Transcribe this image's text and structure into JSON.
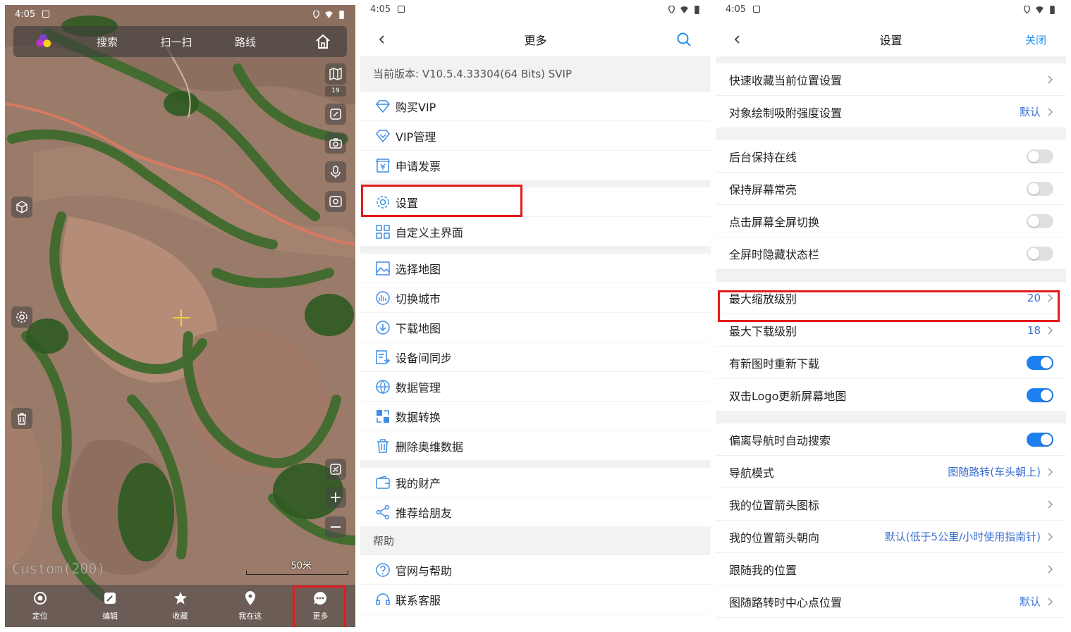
{
  "status": {
    "time": "4:05"
  },
  "map_panel": {
    "topbar": {
      "tabs": [
        "搜索",
        "扫一扫",
        "路线"
      ]
    },
    "zoom_level": "19",
    "map_source_label": "Custom(200)",
    "scale_label": "50米",
    "bottom_nav": [
      {
        "label": "定位",
        "icon": "locate-icon"
      },
      {
        "label": "编辑",
        "icon": "edit-icon"
      },
      {
        "label": "收藏",
        "icon": "star-icon"
      },
      {
        "label": "我在这",
        "icon": "pin-icon"
      },
      {
        "label": "更多",
        "icon": "more-icon"
      }
    ]
  },
  "more_panel": {
    "title": "更多",
    "version": "当前版本: V10.5.4.33304(64 Bits) SVIP",
    "items": {
      "buy_vip": "购买VIP",
      "vip_manage": "VIP管理",
      "invoice": "申请发票",
      "settings": "设置",
      "custom_home": "自定义主界面",
      "select_map": "选择地图",
      "switch_city": "切换城市",
      "download_map": "下载地图",
      "device_sync": "设备间同步",
      "data_manage": "数据管理",
      "data_convert": "数据转换",
      "delete_data": "删除奥维数据",
      "my_assets": "我的财产",
      "recommend": "推荐给朋友"
    },
    "help_header": "帮助",
    "help_items": {
      "website_help": "官网与帮助",
      "contact": "联系客服"
    }
  },
  "settings_panel": {
    "title": "设置",
    "close": "关闭",
    "rows": {
      "quick_fav": {
        "label": "快速收藏当前位置设置"
      },
      "snap_strength": {
        "label": "对象绘制吸附强度设置",
        "value": "默认"
      },
      "bg_online": {
        "label": "后台保持在线",
        "on": false
      },
      "screen_on": {
        "label": "保持屏幕常亮",
        "on": false
      },
      "tap_fullscreen": {
        "label": "点击屏幕全屏切换",
        "on": false
      },
      "hide_statusbar": {
        "label": "全屏时隐藏状态栏",
        "on": false
      },
      "max_zoom": {
        "label": "最大缩放级别",
        "value": "20"
      },
      "max_download": {
        "label": "最大下载级别",
        "value": "18"
      },
      "redownload": {
        "label": "有新图时重新下载",
        "on": true
      },
      "dbl_logo": {
        "label": "双击Logo更新屏幕地图",
        "on": true
      },
      "auto_search": {
        "label": "偏离导航时自动搜索",
        "on": true
      },
      "nav_mode": {
        "label": "导航模式",
        "value": "图随路转(车头朝上)"
      },
      "arrow_icon": {
        "label": "我的位置箭头图标"
      },
      "arrow_dir": {
        "label": "我的位置箭头朝向",
        "value": "默认(低于5公里/小时使用指南针)"
      },
      "follow_me": {
        "label": "跟随我的位置"
      },
      "rotate_center": {
        "label": "图随路转时中心点位置",
        "value": "默认"
      }
    }
  },
  "colors": {
    "accent": "#1e7ff0",
    "highlight": "#e31b1b"
  }
}
